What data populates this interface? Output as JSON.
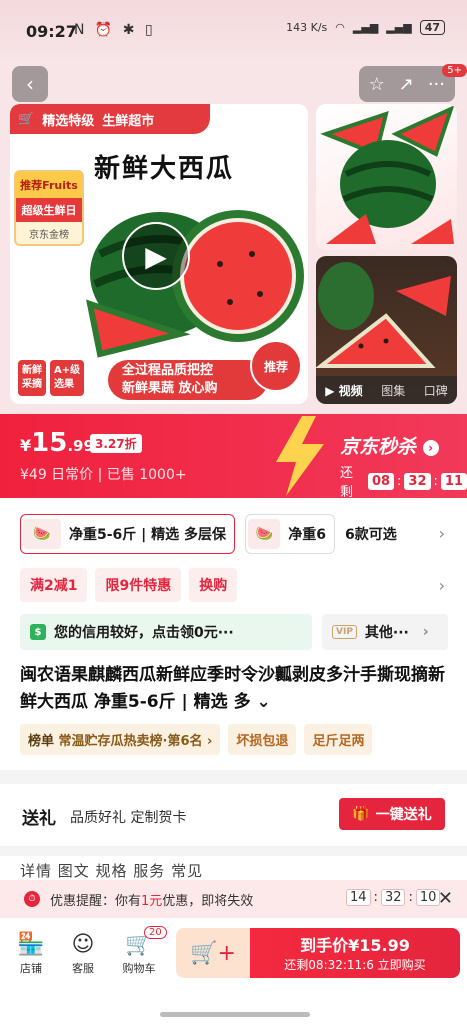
{
  "status": {
    "time": "09:27",
    "speed": "143 K/s",
    "battery": "47"
  },
  "gallery": {
    "banner_left": "精选特级",
    "banner_right": "生鲜超市",
    "headline": "新鲜大西瓜",
    "tag_recommend": "推荐Fruits",
    "tag_super": "超级生鲜日",
    "tag_brand": "京东金榜",
    "corner1": "新鲜\n采摘",
    "corner2": "A+级\n选果",
    "quality_line1": "全过程品质把控",
    "quality_line2": "新鲜果蔬 放心购",
    "recommend": "推荐",
    "notification_badge": "5+",
    "media_tabs": [
      "视频",
      "图集",
      "口碑"
    ]
  },
  "price": {
    "yen": "¥",
    "main": "15",
    "cents": ".99",
    "discount": "3.27折",
    "original": "¥49 日常价 | 已售 1000+",
    "seckill": "京东秒杀",
    "remaining_label": "还剩",
    "countdown": [
      "08",
      "32",
      "11"
    ]
  },
  "sku": {
    "chip1": "净重5-6斤 | 精选 多层保",
    "chip2": "净重6",
    "more": "6款可选"
  },
  "promos": [
    "满2减1",
    "限9件特惠",
    "换购"
  ],
  "credit": {
    "text": "您的信用较好，点击领0元···",
    "other_badge": "VIP",
    "other": "其他···"
  },
  "product_title": "闽农语果麒麟西瓜新鲜应季时令沙瓤剥皮多汁手撕现摘新鲜大西瓜 净重5-6斤 | 精选 多",
  "rank": {
    "label": "榜单",
    "text": "常温贮存瓜热卖榜·第6名 ›",
    "guarantee1": "坏损包退",
    "guarantee2": "足斤足两"
  },
  "gift": {
    "title": "送礼",
    "subtitle": "品质好礼 定制贺卡",
    "button": "一键送礼"
  },
  "spec_peek": "详情  图文  规格  服务  常见",
  "reminder": {
    "prefix": "优惠提醒：你有",
    "amount": "1元",
    "suffix": "优惠，即将失效",
    "countdown": [
      "14",
      "32",
      "10"
    ]
  },
  "bottom": {
    "store": "店铺",
    "service": "客服",
    "cart": "购物车",
    "cart_count": "20",
    "buy_line1": "到手价¥15.99",
    "buy_line2": "还剩08:32:11:6  立即购买"
  }
}
